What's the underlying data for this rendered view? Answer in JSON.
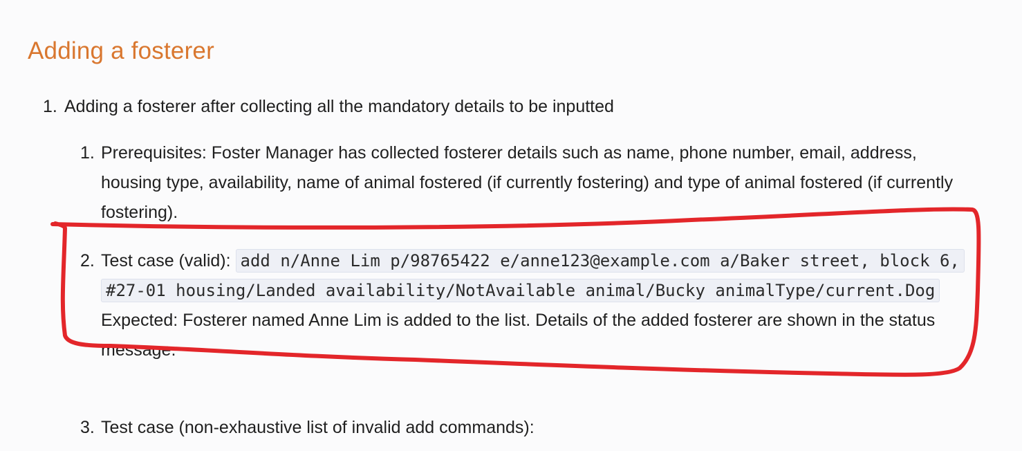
{
  "section": {
    "title": "Adding a fosterer"
  },
  "outer_list": [
    {
      "number": "1.",
      "text": "Adding a fosterer after collecting all the mandatory details to be inputted"
    }
  ],
  "sub_list": [
    {
      "number": "1.",
      "text": "Prerequisites: Foster Manager has collected fosterer details such as name, phone number, email, address, housing type, availability, name of animal fostered (if currently fostering) and type of animal fostered (if currently fostering)."
    },
    {
      "number": "2.",
      "label": "Test case (valid): ",
      "code": "add n/Anne Lim p/98765422 e/anne123@example.com a/Baker street, block 6, #27-01 housing/Landed availability/NotAvailable animal/Bucky animalType/current.Dog",
      "expected": "Expected: Fosterer named Anne Lim is added to the list. Details of the added fosterer are shown in the status message."
    },
    {
      "number": "3.",
      "text": "Test case (non-exhaustive list of invalid add commands):"
    }
  ],
  "annotation": {
    "color": "#e3262a",
    "description": "hand-drawn-red-outline"
  }
}
